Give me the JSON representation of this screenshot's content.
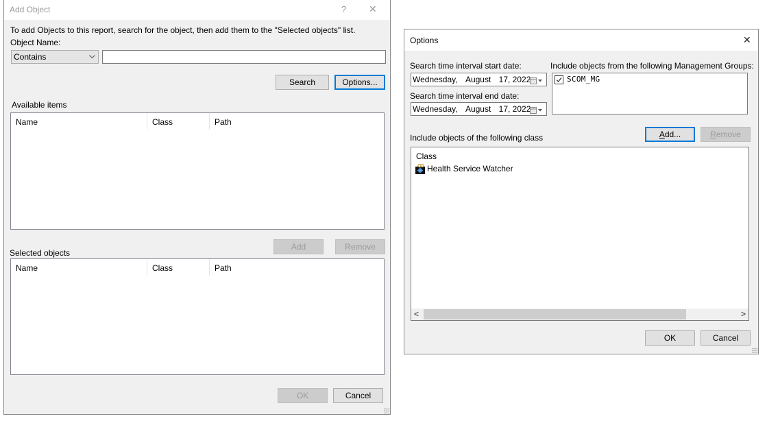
{
  "add_object_dialog": {
    "title": "Add Object",
    "help_glyph": "?",
    "close_glyph": "✕",
    "instructions": "To add Objects to this report, search for the object, then add them to the \"Selected objects\" list.",
    "object_name_label": "Object Name:",
    "match_mode": {
      "selected": "Contains",
      "chevron": "⌵"
    },
    "object_name_value": "",
    "search_button": "Search",
    "options_button": "Options...",
    "available_items": {
      "label": "Available items",
      "columns": [
        "Name",
        "Class",
        "Path"
      ],
      "rows": []
    },
    "add_button": "Add",
    "remove_button": "Remove",
    "selected_objects": {
      "label": "Selected objects",
      "columns": [
        "Name",
        "Class",
        "Path"
      ],
      "rows": []
    },
    "ok_button": "OK",
    "cancel_button": "Cancel"
  },
  "options_dialog": {
    "title": "Options",
    "close_glyph": "✕",
    "start_date_label": "Search time interval start date:",
    "start_date": {
      "weekday": "Wednesday,",
      "month": "August",
      "day_year": "17, 2022"
    },
    "end_date_label": "Search time interval end date:",
    "end_date": {
      "weekday": "Wednesday,",
      "month": "August",
      "day_year": "17, 2022"
    },
    "management_groups_label": "Include objects from the following Management Groups:",
    "management_groups": [
      {
        "name": "SCOM_MG",
        "checked": true
      }
    ],
    "add_button": {
      "underlined": "A",
      "rest": "dd..."
    },
    "remove_button": {
      "underlined": "R",
      "rest": "emove"
    },
    "class_section_label": "Include objects of the following class",
    "class_list": {
      "column": "Class",
      "items": [
        {
          "name": "Health Service Watcher",
          "icon": "health-service-watcher-icon"
        }
      ]
    },
    "scroll_left": "<",
    "scroll_right": ">",
    "ok_button": "OK",
    "cancel_button": "Cancel"
  },
  "colors": {
    "dialog_bg": "#f0f0f0",
    "focus_border": "#0078d7",
    "disabled_button_bg": "#cccccc",
    "disabled_text": "#9a9a9a"
  }
}
